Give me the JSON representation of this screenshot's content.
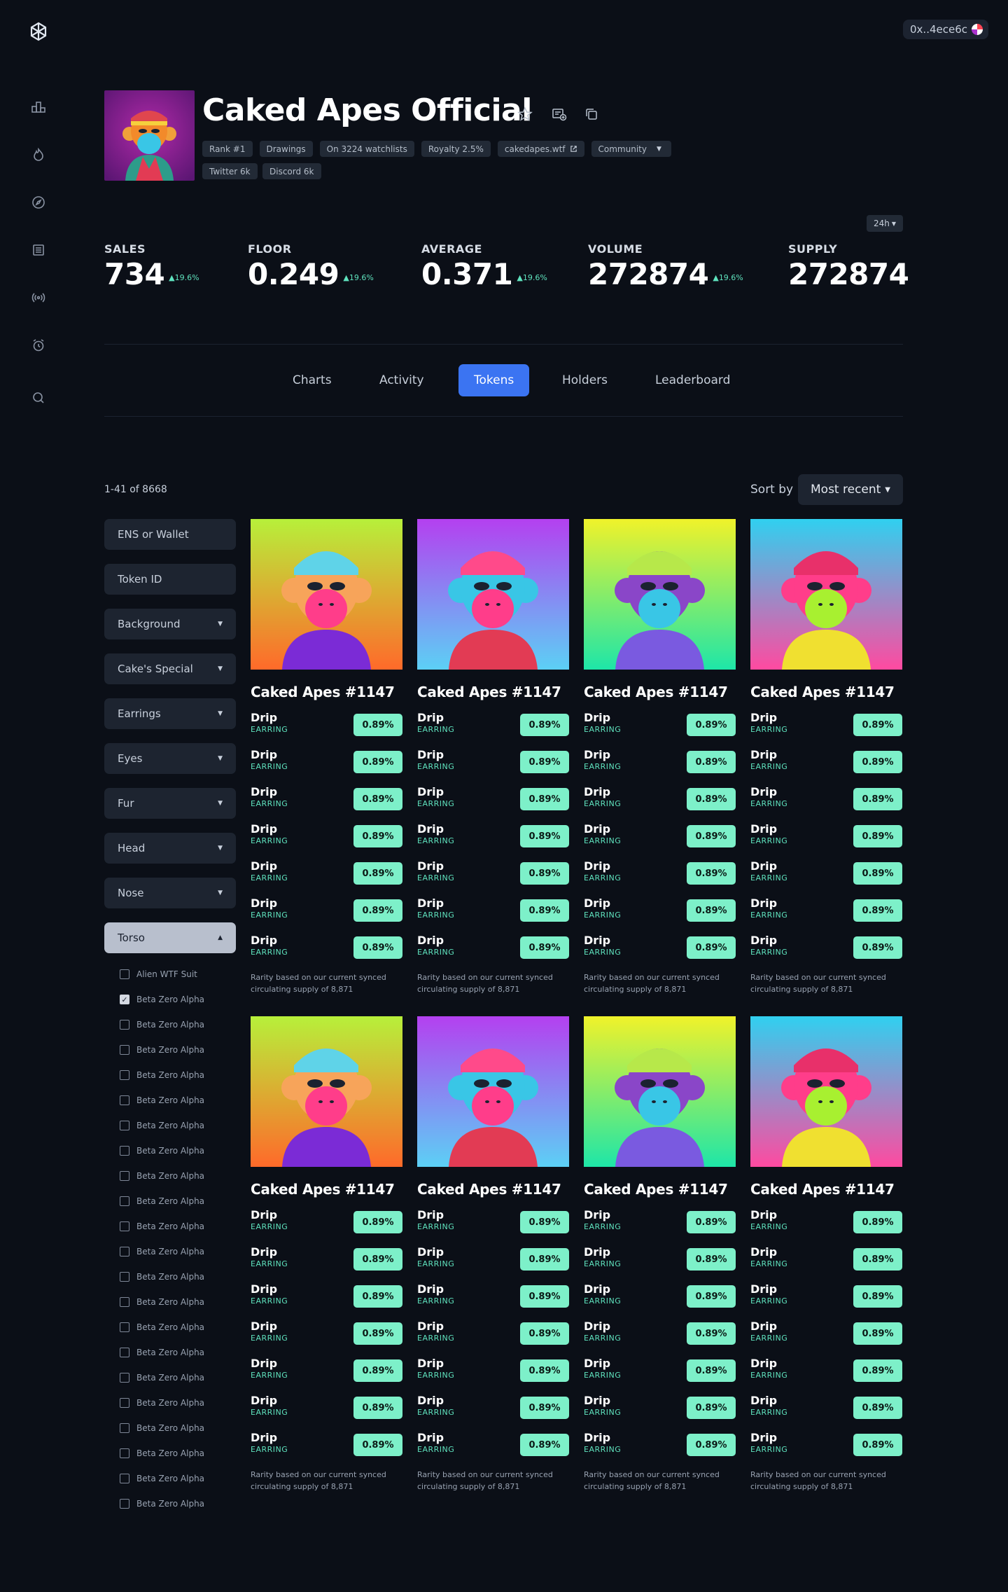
{
  "wallet": {
    "address": "0x..4ece6c"
  },
  "collection": {
    "name": "Caked Apes Official",
    "chips": [
      {
        "label": "Rank #1"
      },
      {
        "label": "Drawings"
      },
      {
        "label": "On 3224 watchlists"
      },
      {
        "label": "Royalty 2.5%"
      },
      {
        "label": "cakedapes.wtf",
        "icon": "external-link-icon"
      },
      {
        "label": "Community",
        "icon": "chevron-down-icon"
      },
      {
        "label": "Twitter 6k"
      },
      {
        "label": "Discord 6k"
      }
    ]
  },
  "stats": {
    "range": "24h",
    "items": [
      {
        "label": "SALES",
        "value": "734",
        "delta": "19.6%"
      },
      {
        "label": "FLOOR",
        "value": "0.249",
        "delta": "19.6%"
      },
      {
        "label": "AVERAGE",
        "value": "0.371",
        "delta": "19.6%"
      },
      {
        "label": "VOLUME",
        "value": "272874",
        "delta": "19.6%"
      },
      {
        "label": "SUPPLY",
        "value": "272874",
        "delta": ""
      }
    ]
  },
  "tabs": [
    "Charts",
    "Activity",
    "Tokens",
    "Holders",
    "Leaderboard"
  ],
  "active_tab": "Tokens",
  "toolbar": {
    "count": "1-41 of 8668",
    "sort_label": "Sort by",
    "sort_value": "Most recent"
  },
  "filters": {
    "wallet_placeholder": "ENS or Wallet",
    "token_placeholder": "Token ID",
    "dropdowns": [
      "Background",
      "Cake's Special",
      "Earrings",
      "Eyes",
      "Fur",
      "Head",
      "Nose"
    ],
    "open": "Torso",
    "options": [
      {
        "label": "Alien WTF Suit",
        "checked": false
      },
      {
        "label": "Beta Zero Alpha",
        "checked": true
      },
      {
        "label": "Beta Zero Alpha",
        "checked": false
      },
      {
        "label": "Beta Zero Alpha",
        "checked": false
      },
      {
        "label": "Beta Zero Alpha",
        "checked": false
      },
      {
        "label": "Beta Zero Alpha",
        "checked": false
      },
      {
        "label": "Beta Zero Alpha",
        "checked": false
      },
      {
        "label": "Beta Zero Alpha",
        "checked": false
      },
      {
        "label": "Beta Zero Alpha",
        "checked": false
      },
      {
        "label": "Beta Zero Alpha",
        "checked": false
      },
      {
        "label": "Beta Zero Alpha",
        "checked": false
      },
      {
        "label": "Beta Zero Alpha",
        "checked": false
      },
      {
        "label": "Beta Zero Alpha",
        "checked": false
      },
      {
        "label": "Beta Zero Alpha",
        "checked": false
      },
      {
        "label": "Beta Zero Alpha",
        "checked": false
      },
      {
        "label": "Beta Zero Alpha",
        "checked": false
      },
      {
        "label": "Beta Zero Alpha",
        "checked": false
      },
      {
        "label": "Beta Zero Alpha",
        "checked": false
      },
      {
        "label": "Beta Zero Alpha",
        "checked": false
      },
      {
        "label": "Beta Zero Alpha",
        "checked": false
      },
      {
        "label": "Beta Zero Alpha",
        "checked": false
      },
      {
        "label": "Beta Zero Alpha",
        "checked": false
      }
    ]
  },
  "tokens": [
    {
      "name": "Caked Apes #1147",
      "art": "ape-cap-hoodie"
    },
    {
      "name": "Caked Apes #1147",
      "art": "ape-party-hat"
    },
    {
      "name": "Caked Apes #1147",
      "art": "ape-blonde-hair"
    },
    {
      "name": "Caked Apes #1147",
      "art": "ape-antlers"
    },
    {
      "name": "Caked Apes #1147",
      "art": "ape-cap-hoodie"
    },
    {
      "name": "Caked Apes #1147",
      "art": "ape-party-hat"
    },
    {
      "name": "Caked Apes #1147",
      "art": "ape-blonde-hair"
    },
    {
      "name": "Caked Apes #1147",
      "art": "ape-antlers"
    }
  ],
  "trait": {
    "name": "Drip",
    "type": "EARRING",
    "rarity": "0.89%",
    "rows": 7
  },
  "rarity_note": "Rarity based on our current synced circulating supply of 8,871",
  "colors": {
    "accent": "#3b74f2",
    "positive": "#5fe3be",
    "pill": "#7df0c9",
    "background": "#0b0f17"
  }
}
